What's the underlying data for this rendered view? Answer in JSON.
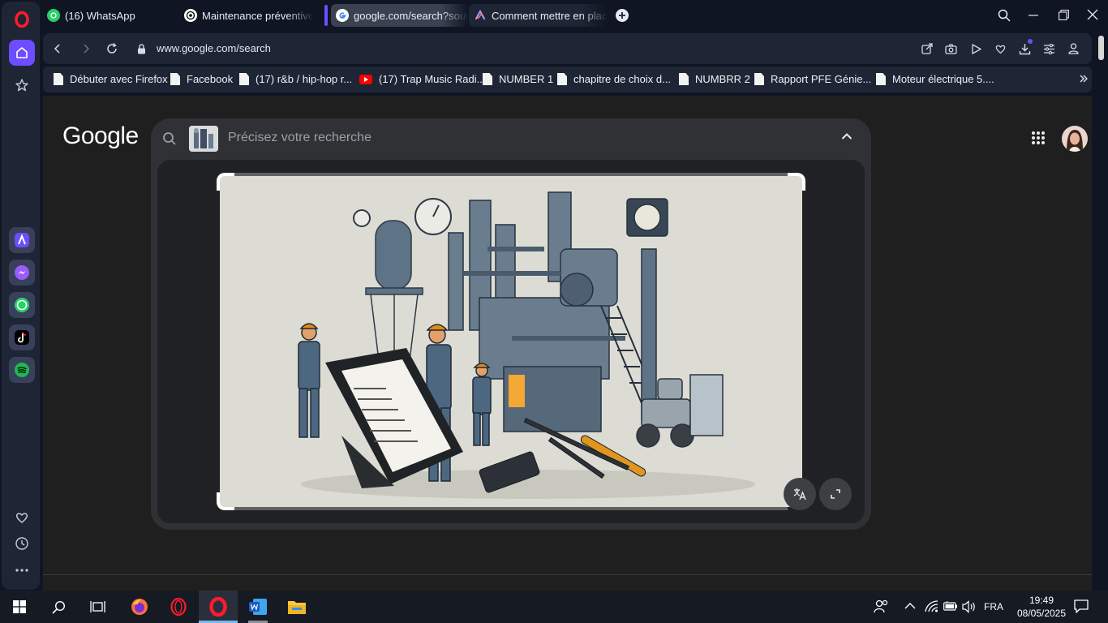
{
  "browser": {
    "tabs": [
      {
        "title": "(16) WhatsApp",
        "icon": "whatsapp-icon",
        "active": false
      },
      {
        "title": "Maintenance préventive in",
        "icon": "chatgpt-icon",
        "active": false
      },
      {
        "title": "google.com/search?source",
        "icon": "google-icon",
        "active": true
      },
      {
        "title": "Comment mettre en place",
        "icon": "claude-icon",
        "active": false
      }
    ],
    "url": "www.google.com/search",
    "bookmarks": [
      {
        "label": "Débuter avec Firefox",
        "icon": "document-icon"
      },
      {
        "label": "Facebook",
        "icon": "document-icon"
      },
      {
        "label": "(17) r&b / hip-hop r...",
        "icon": "document-icon"
      },
      {
        "label": "(17) Trap Music Radi...",
        "icon": "youtube-icon"
      },
      {
        "label": "NUMBER 1",
        "icon": "document-icon"
      },
      {
        "label": "chapitre de choix d...",
        "icon": "document-icon"
      },
      {
        "label": "NUMBRR 2",
        "icon": "document-icon"
      },
      {
        "label": "Rapport PFE Génie...",
        "icon": "document-icon"
      },
      {
        "label": "Moteur électrique 5....",
        "icon": "document-icon"
      }
    ]
  },
  "google": {
    "logo": "Google",
    "search_placeholder": "Précisez votre recherche"
  },
  "taskbar": {
    "language": "FRA",
    "time": "19:49",
    "date": "08/05/2025"
  },
  "colors": {
    "opera_red": "#ff1b2d",
    "accent_purple": "#6c4dff",
    "whatsapp_green": "#25d366",
    "spotify_green": "#1db954"
  }
}
